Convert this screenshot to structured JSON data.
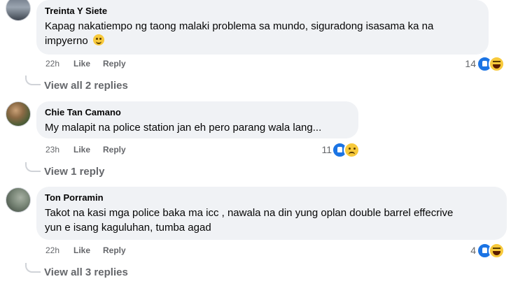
{
  "comments": [
    {
      "author": "Treinta Y Siete",
      "text": "Kapag nakatiempo ng taong malaki problema sa mundo, siguradong isasama ka na impyerno",
      "text_line1": "Kapag nakatiempo ng taong malaki problema sa mundo, siguradong isasama ka na",
      "text_line2": "impyerno",
      "inline_emoji": "grinning-sweat-emoji",
      "time": "22h",
      "like_label": "Like",
      "reply_label": "Reply",
      "reaction_count": "14",
      "reactions": [
        "like",
        "haha"
      ],
      "view_replies": "View all 2 replies"
    },
    {
      "author": "Chie Tan Camano",
      "text": "My malapit na police station jan eh pero parang wala lang...",
      "time": "23h",
      "like_label": "Like",
      "reply_label": "Reply",
      "reaction_count": "11",
      "reactions": [
        "like",
        "sad"
      ],
      "view_replies": "View 1 reply"
    },
    {
      "author": "Ton Porramin",
      "text_line1": "Takot na kasi mga police baka ma icc , nawala na din yung oplan double barrel effecrive",
      "text_line2": "yun e isang kaguluhan, tumba agad",
      "time": "22h",
      "like_label": "Like",
      "reply_label": "Reply",
      "reaction_count": "4",
      "reactions": [
        "like",
        "haha"
      ],
      "view_replies": "View all 3 replies"
    }
  ],
  "colors": {
    "bubble": "#f0f2f5",
    "meta_text": "#65676b",
    "like_blue": "#1b74e4",
    "emoji_yellow": "#f7c93b"
  }
}
